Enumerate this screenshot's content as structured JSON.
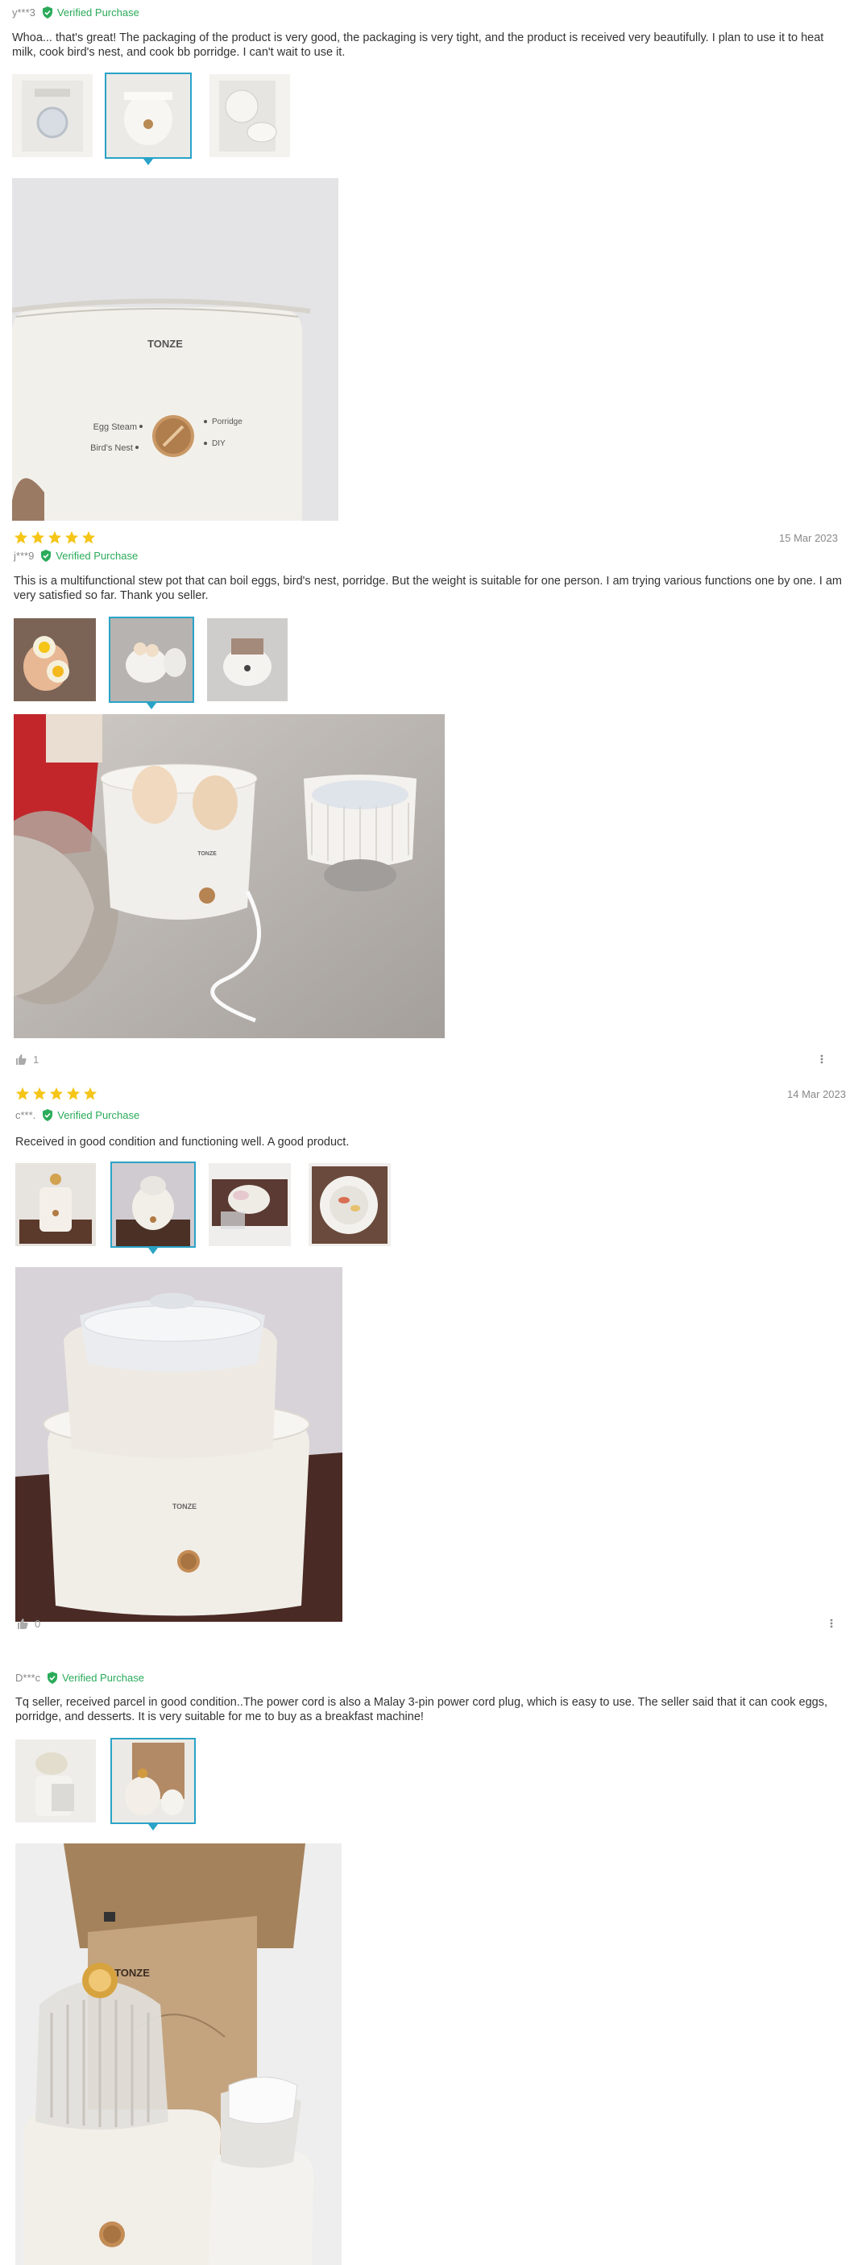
{
  "reviews": [
    {
      "user": "y***3",
      "verified": "Verified Purchase",
      "text": "Whoa... that's great! The packaging of the product is very good, the packaging is very tight, and the product is received very beautifully. I plan to use it to heat milk, cook bird's nest, and cook bb porridge. I can't wait to use it.",
      "photo": {
        "brand": "TONZE",
        "left_labels": [
          "Egg Steam",
          "Bird's Nest"
        ],
        "right_labels": [
          "Porridge",
          "DIY"
        ]
      }
    },
    {
      "rating": 5,
      "date": "15 Mar 2023",
      "user": "j***9",
      "verified": "Verified Purchase",
      "text": "This is a multifunctional stew pot that can boil eggs, bird's nest, porridge. But the weight is suitable for one person. I am trying various functions one by one. I am very satisfied so far. Thank you seller.",
      "photo": {
        "brand": "TONZE"
      },
      "likes": "1"
    },
    {
      "rating": 5,
      "date": "14 Mar 2023",
      "user": "c***.",
      "verified": "Verified Purchase",
      "text": "Received in good condition and functioning well. A good product.",
      "photo": {
        "brand": "TONZE"
      },
      "likes": "0"
    },
    {
      "user": "D***c",
      "verified": "Verified Purchase",
      "text": "Tq seller, received parcel in good condition..The power cord is also a Malay 3-pin power cord plug, which is easy to use. The seller said that it can cook eggs, porridge, and desserts. It is very suitable for me to buy as a breakfast machine!",
      "photo": {
        "brand": "TONZE"
      }
    }
  ],
  "colors": {
    "accent": "#2aa3c7",
    "verified": "#2aab5a",
    "star": "#f5c518"
  }
}
